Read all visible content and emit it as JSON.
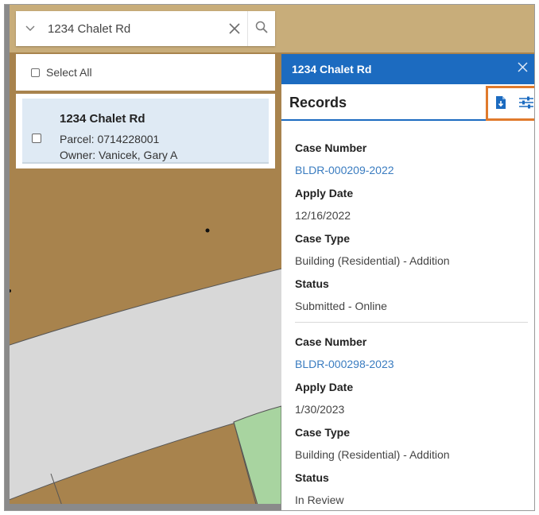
{
  "search": {
    "value": "1234 Chalet Rd",
    "clear_glyph": "✕",
    "dropdown_icon": "caret-down-icon",
    "search_icon": "search-icon"
  },
  "results": {
    "select_all_label": "Select All",
    "items": [
      {
        "title": "1234 Chalet Rd",
        "parcel": "Parcel: 0714228001",
        "owner": "Owner: Vanicek, Gary A"
      }
    ]
  },
  "panel": {
    "title": "1234 Chalet Rd",
    "close_glyph": "✕",
    "heading": "Records",
    "tools": [
      "export-icon",
      "filter-icon"
    ],
    "records": [
      {
        "case_number_label": "Case Number",
        "case_number": "BLDR-000209-2022",
        "apply_date_label": "Apply Date",
        "apply_date": "12/16/2022",
        "case_type_label": "Case Type",
        "case_type": "Building (Residential) - Addition",
        "status_label": "Status",
        "status": "Submitted - Online"
      },
      {
        "case_number_label": "Case Number",
        "case_number": "BLDR-000298-2023",
        "apply_date_label": "Apply Date",
        "apply_date": "1/30/2023",
        "case_type_label": "Case Type",
        "case_type": "Building (Residential) - Addition",
        "status_label": "Status",
        "status": "In Review"
      }
    ]
  },
  "colors": {
    "accent": "#1c6bc0",
    "highlight": "#e07a2c",
    "map_parcel": "#a8834d",
    "map_road": "#d8d8d8",
    "map_park": "#a8d4a0",
    "link": "#3a7cc0"
  }
}
